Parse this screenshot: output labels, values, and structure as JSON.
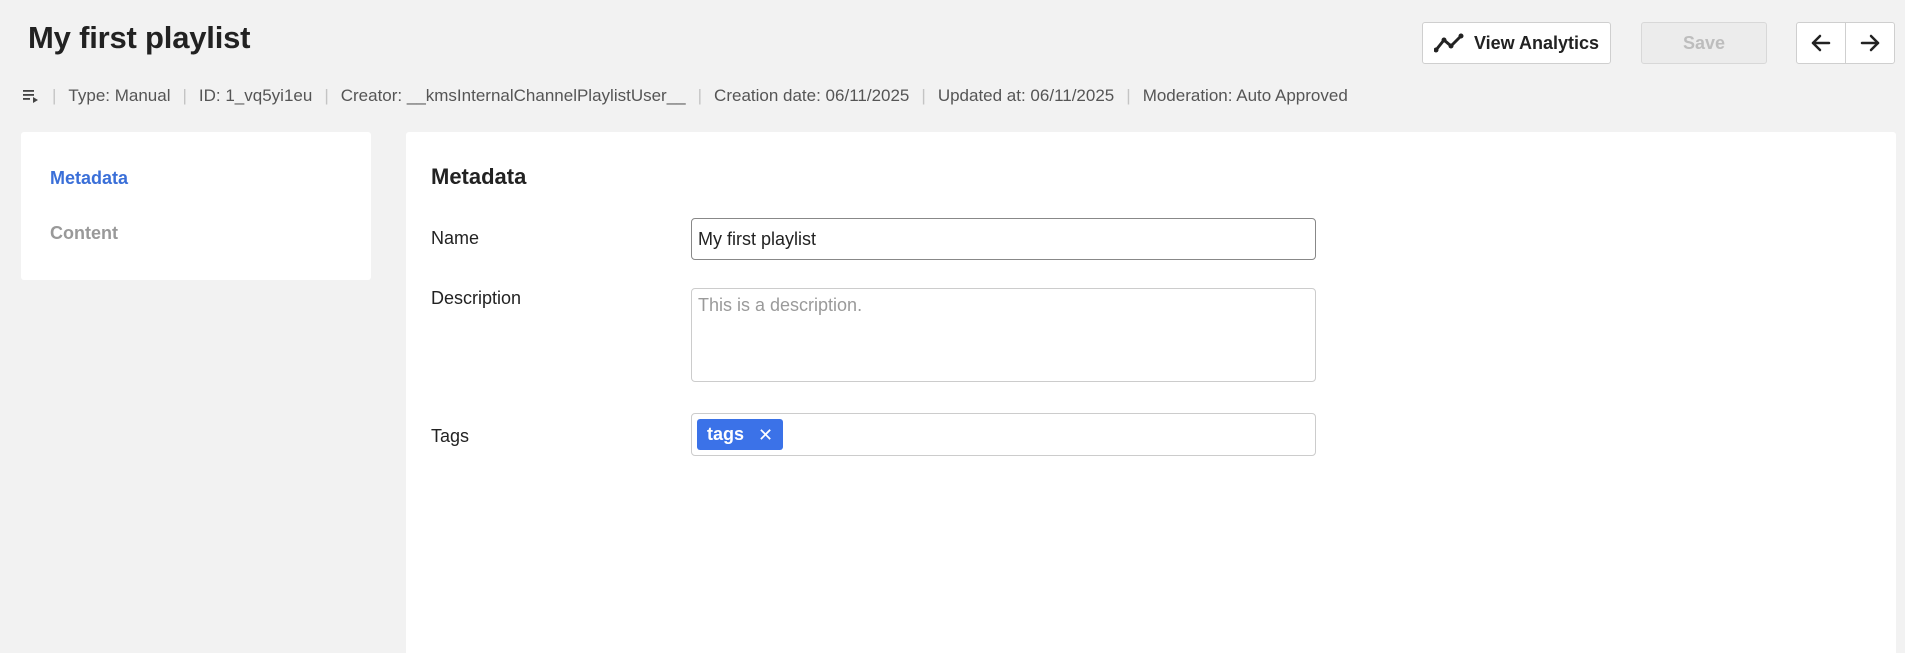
{
  "header": {
    "title": "My first playlist",
    "analytics_label": "View Analytics",
    "save_label": "Save"
  },
  "meta": {
    "type": "Type: Manual",
    "id": "ID: 1_vq5yi1eu",
    "creator": "Creator: __kmsInternalChannelPlaylistUser__",
    "creation_date": "Creation date: 06/11/2025",
    "updated_at": "Updated at: 06/11/2025",
    "moderation": "Moderation: Auto Approved"
  },
  "sidebar": {
    "items": [
      {
        "label": "Metadata",
        "active": true
      },
      {
        "label": "Content",
        "active": false
      }
    ]
  },
  "main": {
    "section_title": "Metadata",
    "fields": {
      "name_label": "Name",
      "name_value": "My first playlist",
      "description_label": "Description",
      "description_placeholder": "This is a description.",
      "tags_label": "Tags",
      "tags": [
        "tags"
      ]
    }
  },
  "icons": {
    "analytics": "analytics-trend-icon",
    "back": "arrow-left-icon",
    "forward": "arrow-right-icon",
    "playlist": "playlist-icon",
    "tag_remove": "close-icon"
  },
  "colors": {
    "accent": "#3a6fd8",
    "tag_bg": "#3b72e8",
    "page_bg": "#f2f2f2"
  }
}
